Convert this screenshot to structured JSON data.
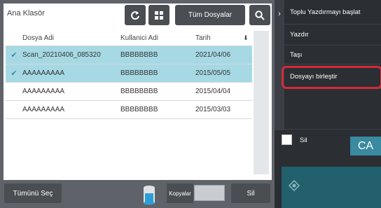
{
  "header": {
    "folder_title": "Ana Klasör",
    "all_files_label": "Tüm Dosyalar"
  },
  "table": {
    "columns": [
      "Dosya Adi",
      "Kullanici Adi",
      "Tarih"
    ],
    "rows": [
      {
        "selected": true,
        "name": "Scan_20210406_085320",
        "user": "BBBBBBBB",
        "date": "2021/04/06"
      },
      {
        "selected": true,
        "name": "AAAAAAAAA",
        "user": "BBBBBBBB",
        "date": "2015/05/05"
      },
      {
        "selected": false,
        "name": "AAAAAAAAA",
        "user": "BBBBBBBB",
        "date": "2015/04/04"
      },
      {
        "selected": false,
        "name": "AAAAAAAAA",
        "user": "BBBBBBBB",
        "date": "2015/03/03"
      }
    ]
  },
  "bottom": {
    "select_all_label": "Tümünü Seç",
    "copies_label": "Kopyalar",
    "copies_value": "",
    "print_label": "Sil"
  },
  "menu": {
    "items": [
      "Toplu Yazdırmayı başlat",
      "Yazdır",
      "Taşı",
      "Dosyayı birleştir"
    ]
  },
  "delete_check": {
    "label": "Sil"
  },
  "ca_label": "CA",
  "colors": {
    "accent": "#3a8aa0",
    "highlight": "#d42a3a",
    "selected_row": "#a6d9e4"
  },
  "icons": {
    "refresh": "refresh-icon",
    "grid": "grid-icon",
    "search": "search-icon",
    "collapse": "chevron-right-icon",
    "sort": "sort-down-icon",
    "check": "check-icon",
    "start": "start-icon"
  }
}
